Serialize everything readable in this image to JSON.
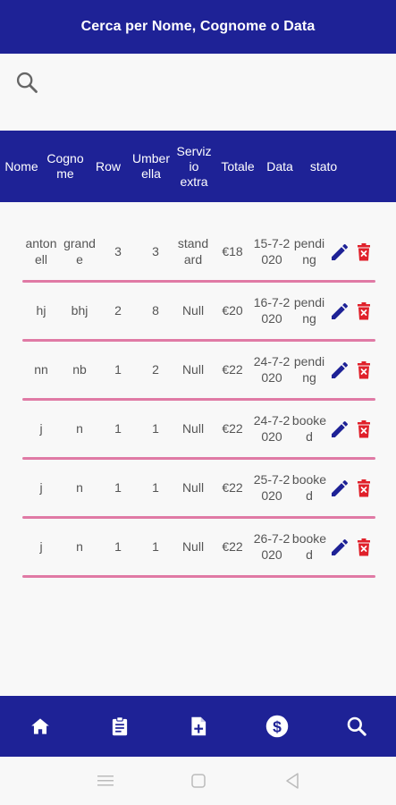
{
  "header": {
    "title": "Cerca per Nome, Cognome o Data"
  },
  "search": {
    "icon": "search-icon",
    "value": "",
    "placeholder": ""
  },
  "table": {
    "columns": [
      {
        "key": "nome",
        "label": "Nome"
      },
      {
        "key": "cognome",
        "label": "Cogno\nme"
      },
      {
        "key": "row",
        "label": "Row"
      },
      {
        "key": "umbrella",
        "label": "Umber\nella"
      },
      {
        "key": "servizio",
        "label": "Serviz\nio\nextra"
      },
      {
        "key": "totale",
        "label": "Totale"
      },
      {
        "key": "data",
        "label": "Data"
      },
      {
        "key": "stato",
        "label": "stato"
      }
    ],
    "rows": [
      {
        "nome": "anton\nell",
        "cognome": "grand\ne",
        "row": "3",
        "umbrella": "3",
        "servizio": "stand\nard",
        "totale": "€18",
        "data": "15-7-2\n020",
        "stato": "pendi\nng"
      },
      {
        "nome": "hj",
        "cognome": "bhj",
        "row": "2",
        "umbrella": "8",
        "servizio": "Null",
        "totale": "€20",
        "data": "16-7-2\n020",
        "stato": "pendi\nng"
      },
      {
        "nome": "nn",
        "cognome": "nb",
        "row": "1",
        "umbrella": "2",
        "servizio": "Null",
        "totale": "€22",
        "data": "24-7-2\n020",
        "stato": "pendi\nng"
      },
      {
        "nome": "j",
        "cognome": "n",
        "row": "1",
        "umbrella": "1",
        "servizio": "Null",
        "totale": "€22",
        "data": "24-7-2\n020",
        "stato": "booke\nd"
      },
      {
        "nome": "j",
        "cognome": "n",
        "row": "1",
        "umbrella": "1",
        "servizio": "Null",
        "totale": "€22",
        "data": "25-7-2\n020",
        "stato": "booke\nd"
      },
      {
        "nome": "j",
        "cognome": "n",
        "row": "1",
        "umbrella": "1",
        "servizio": "Null",
        "totale": "€22",
        "data": "26-7-2\n020",
        "stato": "booke\nd"
      }
    ],
    "actions": {
      "edit_icon": "pencil-icon",
      "delete_icon": "trash-icon"
    }
  },
  "bottom_nav": {
    "items": [
      {
        "icon": "home-icon"
      },
      {
        "icon": "clipboard-icon"
      },
      {
        "icon": "add-file-icon"
      },
      {
        "icon": "dollar-icon"
      },
      {
        "icon": "search-icon"
      }
    ]
  },
  "system_nav": {
    "items": [
      "menu-icon",
      "home-square-icon",
      "back-icon"
    ]
  },
  "colors": {
    "primary": "#1e2296",
    "divider": "#e07aa5",
    "delete": "#e0202a",
    "text": "#555555",
    "background": "#f8f8f8"
  }
}
